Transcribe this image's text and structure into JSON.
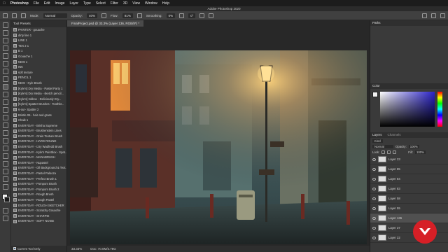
{
  "menubar": {
    "app": "Photoshop",
    "items": [
      "File",
      "Edit",
      "Image",
      "Layer",
      "Type",
      "Select",
      "Filter",
      "3D",
      "View",
      "Window",
      "Help"
    ],
    "clock": ""
  },
  "window_title": "Adobe Photoshop 2020",
  "options": {
    "mode_label": "Mode:",
    "mode_value": "Normal",
    "opacity_label": "Opacity:",
    "opacity_value": "40%",
    "flow_label": "Flow:",
    "flow_value": "81%",
    "smoothing_label": "Smoothing:",
    "smoothing_value": "0%",
    "angle_value": "0°"
  },
  "tool_presets": {
    "title": "Tool Presets",
    "items": [
      "PAINTER - gouache",
      "dirty line 1",
      "LINE 1",
      "TEX 2 1",
      "B 1",
      "Gouache 1",
      "NEW 1",
      "INK",
      "soft texture",
      "PENCIL 1",
      "NEW - Kyle Brush",
      "[Kyle's] Dry Media - Pastel Party 1",
      "[Kyle's] Dry Media - sketch pencil...",
      "[Kyle's] Inkbox - Deliciously Dry...",
      "[Kyle's] Spatter Brushes - Toothbr...",
      "6-our- Spatter 2",
      "Bristle 06 - hair and grass",
      "Chalk 1",
      "EVERYDAY - Brisha Supreme",
      "EVERYDAY - Brushenstein Lines",
      "EVERYDAY - Grain Texture Brush",
      "EVERYDAY - HARD ROUND",
      "EVERYDAY - Izzy Wadfedd Brush",
      "EVERYDAY - Kyle's Paintbox - Spat...",
      "EVERYDAY - MANABRUSH",
      "EVERYDAY - Nupastel",
      "EVERYDAY - Oil Background & Text...",
      "EVERYDAY - Pastel Palooza",
      "EVERYDAY - Perfect Brush 1",
      "EVERYDAY - Pompom Brush",
      "EVERYDAY - Pompom Brush 2",
      "EVERYDAY - Rough Brush",
      "EVERYDAY - Rough Pastel",
      "EVERYDAY - ROUGH SKETCHER",
      "EVERYDAY - Scratchy Gouache",
      "EVERYDAY - SHARPIE",
      "EVERYDAY - SOFT NOISE"
    ],
    "footer": "Current Tool Only"
  },
  "document": {
    "tab": "FinalProject.psd @ 33.3% (Layer 136, RGB/8*) *",
    "zoom": "33.33%",
    "doc_size": "Doc: 70.0M/3.78G"
  },
  "panels": {
    "paths_title": "Paths",
    "color_title": "Color",
    "layers_tab": "Layers",
    "channels_tab": "Channels",
    "kind_label": "Kind",
    "blend_mode": "Normal",
    "opacity_label": "Opacity:",
    "opacity_value": "100%",
    "lock_label": "Lock:",
    "fill_label": "Fill:",
    "fill_value": "100%",
    "layers": [
      {
        "name": "Layer 23",
        "selected": false
      },
      {
        "name": "Layer 85",
        "selected": false
      },
      {
        "name": "Layer 84",
        "selected": false
      },
      {
        "name": "Layer 83",
        "selected": false
      },
      {
        "name": "Layer 58",
        "selected": false
      },
      {
        "name": "Layer 55",
        "selected": false
      },
      {
        "name": "Layer 136",
        "selected": true
      },
      {
        "name": "Layer 37",
        "selected": false
      },
      {
        "name": "Layer 22",
        "selected": false
      }
    ]
  },
  "colors": {
    "chrome": "#3a3a3a",
    "selection": "#4d6b8a",
    "lamp_glow": "#ffb54a",
    "brand_badge": "#d61f26"
  }
}
